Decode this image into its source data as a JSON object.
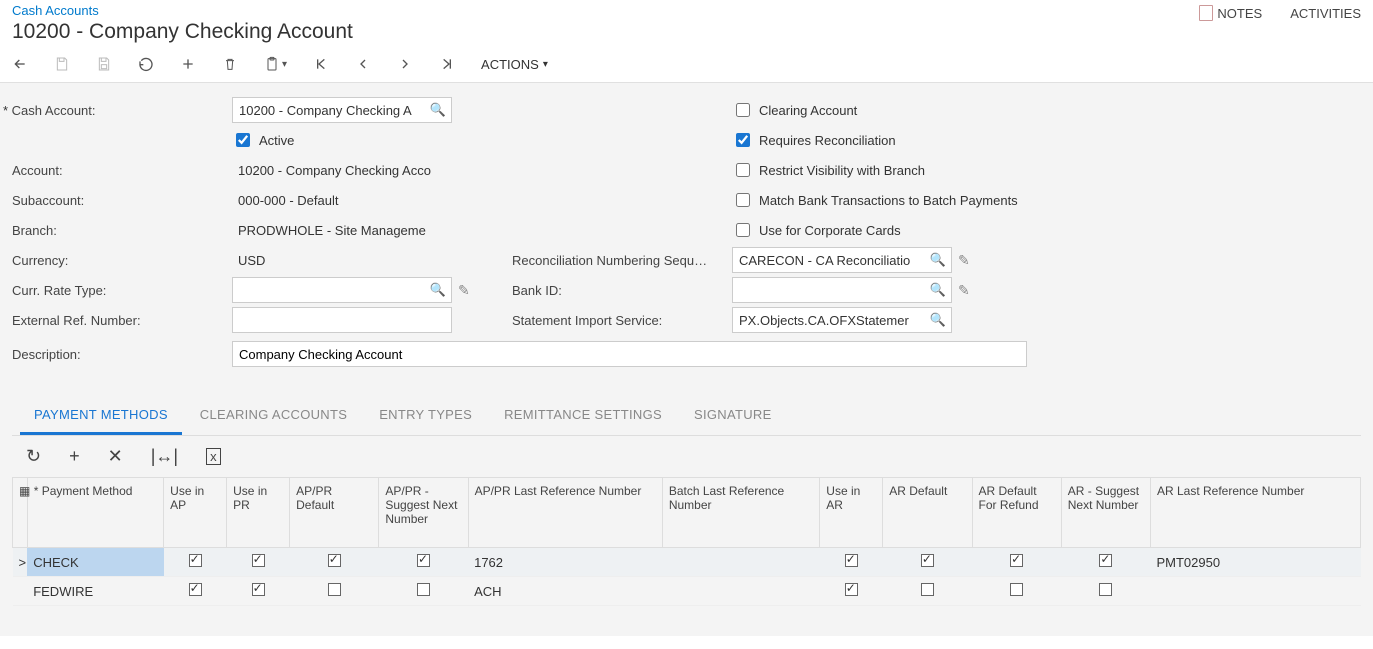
{
  "breadcrumb": "Cash Accounts",
  "title": "10200 - Company Checking Account",
  "header_actions": {
    "notes": "NOTES",
    "activities": "ACTIVITIES"
  },
  "toolbar": {
    "actions": "ACTIONS"
  },
  "form": {
    "cash_account": {
      "label": "Cash Account:",
      "value": "10200 - Company Checking A"
    },
    "active": {
      "label": "Active",
      "checked": true
    },
    "account": {
      "label": "Account:",
      "value": "10200 - Company Checking Acco"
    },
    "subaccount": {
      "label": "Subaccount:",
      "value": "000-000 - Default"
    },
    "branch": {
      "label": "Branch:",
      "value": "PRODWHOLE - Site Manageme"
    },
    "currency": {
      "label": "Currency:",
      "value": "USD"
    },
    "rate_type": {
      "label": "Curr. Rate Type:",
      "value": ""
    },
    "ext_ref": {
      "label": "External Ref. Number:",
      "value": ""
    },
    "description": {
      "label": "Description:",
      "value": "Company Checking Account"
    },
    "clearing": {
      "label": "Clearing Account",
      "checked": false
    },
    "requires_recon": {
      "label": "Requires Reconciliation",
      "checked": true
    },
    "restrict_vis": {
      "label": "Restrict Visibility with Branch",
      "checked": false
    },
    "match_batch": {
      "label": "Match Bank Transactions to Batch Payments",
      "checked": false
    },
    "corp_cards": {
      "label": "Use for Corporate Cards",
      "checked": false
    },
    "recon_seq": {
      "label": "Reconciliation Numbering Sequ…",
      "value": "CARECON - CA Reconciliatio"
    },
    "bank_id": {
      "label": "Bank ID:",
      "value": ""
    },
    "stmt_import": {
      "label": "Statement Import Service:",
      "value": "PX.Objects.CA.OFXStatemer"
    }
  },
  "tabs": [
    "PAYMENT METHODS",
    "CLEARING ACCOUNTS",
    "ENTRY TYPES",
    "REMITTANCE SETTINGS",
    "SIGNATURE"
  ],
  "active_tab": 0,
  "grid": {
    "headers": {
      "req_mark": "*",
      "payment_method": "Payment Method",
      "use_ap": "Use in AP",
      "use_pr": "Use in PR",
      "appr_default": "AP/PR Default",
      "appr_suggest": "AP/PR - Suggest Next Number",
      "appr_last": "AP/PR Last Reference Number",
      "batch_last": "Batch Last Reference Number",
      "use_ar": "Use in AR",
      "ar_default": "AR Default",
      "ar_default_refund": "AR Default For Refund",
      "ar_suggest": "AR - Suggest Next Number",
      "ar_last": "AR Last Reference Number"
    },
    "rows": [
      {
        "selected": true,
        "indicator": ">",
        "payment_method": "CHECK",
        "use_ap": true,
        "use_pr": true,
        "appr_default": true,
        "appr_suggest": true,
        "appr_last": "1762",
        "batch_last": "",
        "use_ar": true,
        "ar_default": true,
        "ar_default_refund": true,
        "ar_suggest": true,
        "ar_last": "PMT02950"
      },
      {
        "selected": false,
        "indicator": "",
        "payment_method": "FEDWIRE",
        "use_ap": true,
        "use_pr": true,
        "appr_default": false,
        "appr_suggest": false,
        "appr_last": "ACH",
        "batch_last": "",
        "use_ar": true,
        "ar_default": false,
        "ar_default_refund": false,
        "ar_suggest": false,
        "ar_last": ""
      }
    ]
  }
}
